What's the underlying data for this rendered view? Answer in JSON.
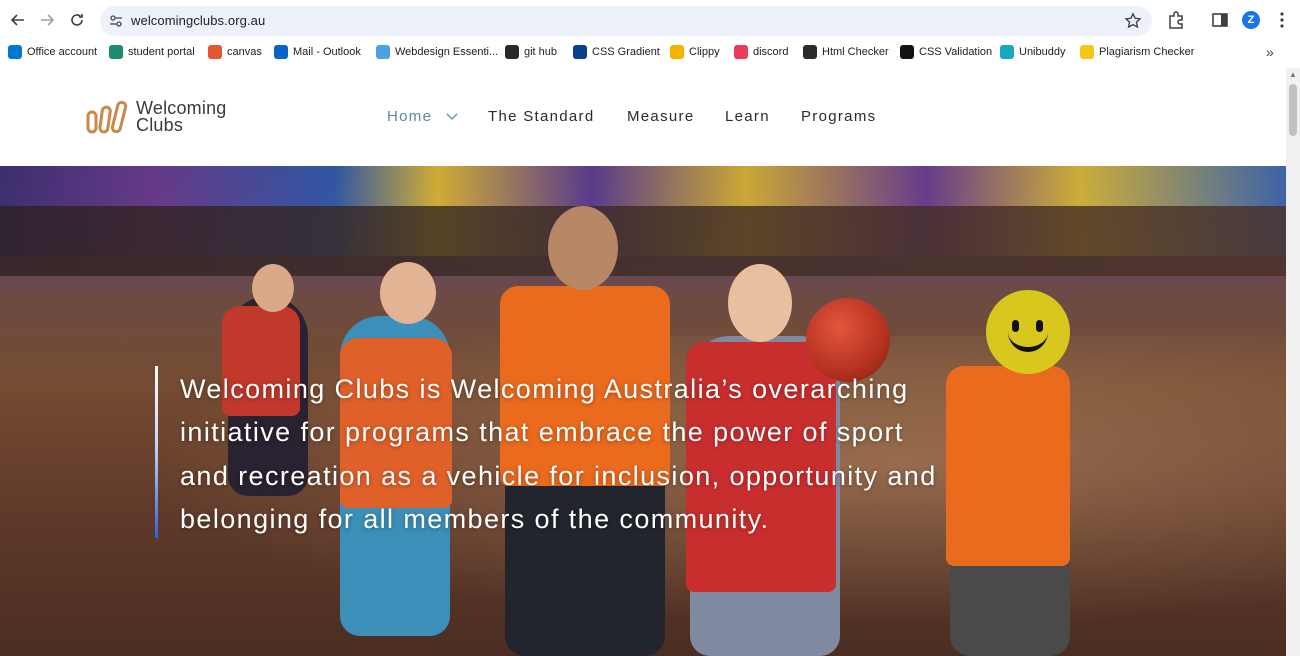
{
  "browser": {
    "url": "welcomingclubs.org.au",
    "profile_initial": "Z",
    "bookmarks": [
      {
        "label": "Office account",
        "color": "#0078d4"
      },
      {
        "label": "student portal",
        "color": "#1f8a70"
      },
      {
        "label": "canvas",
        "color": "#e4572e"
      },
      {
        "label": "Mail - Outlook",
        "color": "#0a64c8"
      },
      {
        "label": "Webdesign Essenti...",
        "color": "#4aa3df"
      },
      {
        "label": "git hub",
        "color": "#24292e"
      },
      {
        "label": "CSS Gradient",
        "color": "#0b3d91"
      },
      {
        "label": "Clippy",
        "color": "#f4b400"
      },
      {
        "label": "discord",
        "color": "#e83e5c"
      },
      {
        "label": "Html Checker",
        "color": "#2a2a2a"
      },
      {
        "label": "CSS Validation",
        "color": "#111111"
      },
      {
        "label": "Unibuddy",
        "color": "#17a9c2"
      },
      {
        "label": "Plagiarism Checker",
        "color": "#f5c518"
      }
    ],
    "more_label": "»"
  },
  "site": {
    "logo_line1": "Welcoming",
    "logo_line2": "Clubs",
    "logo_color": "#c8894b",
    "nav": {
      "home": "Home",
      "standard": "The Standard",
      "measure": "Measure",
      "learn": "Learn",
      "programs": "Programs"
    },
    "accent_color": "#5a8aa8"
  },
  "hero": {
    "text": "Welcoming Clubs is Welcoming Australia’s overarching initiative for programs that embrace the power of sport and recreation as a vehicle for inclusion, opportunity and belonging for all members of the community."
  }
}
